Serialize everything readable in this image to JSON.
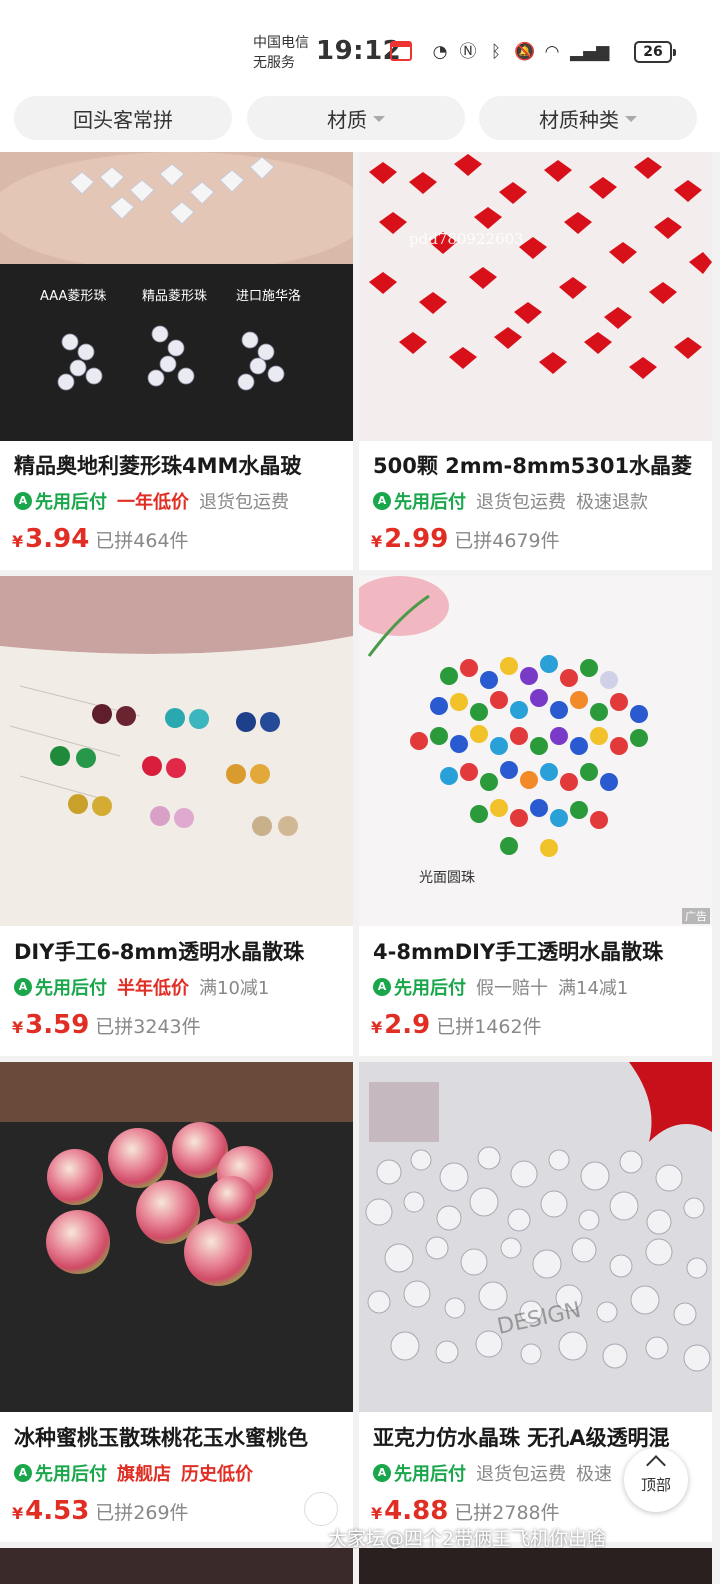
{
  "status_bar": {
    "carrier_line1": "中国电信",
    "carrier_line2": "无服务",
    "time": "19:12",
    "battery": "26",
    "icons": [
      "nfc-icon",
      "bluetooth-icon",
      "mute-icon",
      "wifi-icon",
      "signal-icon"
    ]
  },
  "filters": {
    "chip1": "回头客常拼",
    "chip2": "材质",
    "chip3": "材质种类"
  },
  "products": [
    {
      "title": "精品奥地利菱形珠4MM水晶玻",
      "tags": [
        "先用后付",
        "一年低价",
        "退货包运费"
      ],
      "price": "3.94",
      "sold": "已拼464件",
      "image_labels": [
        "AAA菱形珠",
        "精品菱形珠",
        "进口施华洛"
      ]
    },
    {
      "title": "500颗 2mm-8mm5301水晶菱",
      "tags": [
        "先用后付",
        "退货包运费",
        "极速退款"
      ],
      "price": "2.99",
      "sold": "已拼4679件",
      "image_labels": [
        "pdd780922603"
      ]
    },
    {
      "title": "DIY手工6-8mm透明水晶散珠",
      "tags": [
        "先用后付",
        "半年低价",
        "满10减1"
      ],
      "price": "3.59",
      "sold": "已拼3243件"
    },
    {
      "title": "4-8mmDIY手工透明水晶散珠",
      "tags": [
        "先用后付",
        "假一赔十",
        "满14减1"
      ],
      "price": "2.9",
      "sold": "已拼1462件",
      "image_labels": [
        "光面圆珠",
        "广告"
      ]
    },
    {
      "title": "冰种蜜桃玉散珠桃花玉水蜜桃色",
      "tags": [
        "先用后付",
        "旗舰店",
        "历史低价"
      ],
      "price": "4.53",
      "sold": "已拼269件"
    },
    {
      "title": "亚克力仿水晶珠 无孔A级透明混",
      "tags": [
        "先用后付",
        "退货包运费",
        "极速"
      ],
      "price": "4.88",
      "sold": "已拼2788件",
      "image_labels": [
        "DESIGN"
      ]
    }
  ],
  "top_button": "顶部",
  "currency_symbol": "¥",
  "watermark": "大家坛@四个2带俩王飞机你出啥"
}
